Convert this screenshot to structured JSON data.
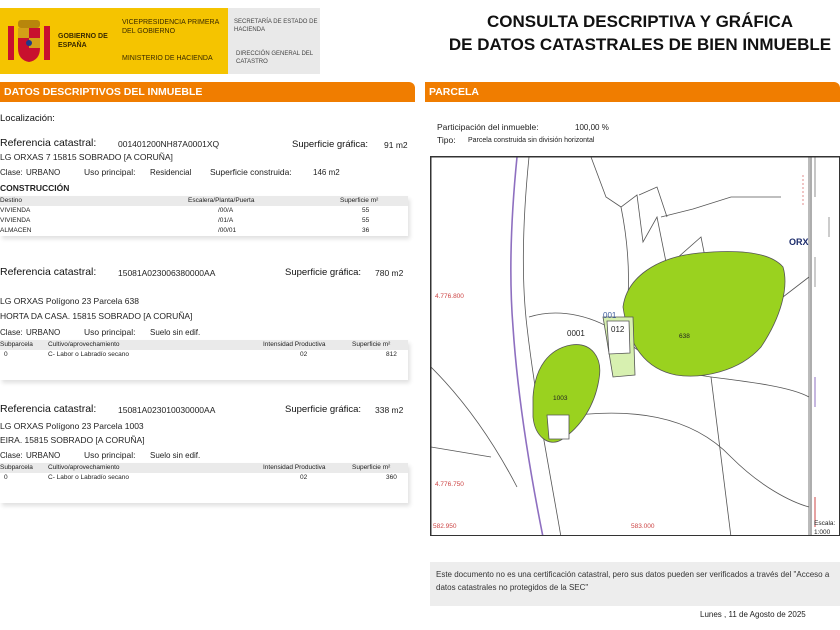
{
  "header": {
    "gob_name": "GOBIERNO DE ESPAÑA",
    "vicepresidencia": "VICEPRESIDENCIA PRIMERA DEL GOBIERNO",
    "ministerio": "MINISTERIO DE HACIENDA",
    "secretaria": "SECRETARÍA DE ESTADO DE HACIENDA",
    "direccion": "DIRECCIÓN GENERAL DEL CATASTRO",
    "title_line1": "CONSULTA DESCRIPTIVA Y GRÁFICA",
    "title_line2": "DE DATOS CATASTRALES DE BIEN INMUEBLE"
  },
  "left": {
    "section_title": "DATOS DESCRIPTIVOS DEL INMUEBLE",
    "localizacion": "Localización:",
    "block1": {
      "ref_label": "Referencia catastral:",
      "ref_value": "001401200NH87A0001XQ",
      "sup_label": "Superficie gráfica:",
      "sup_value": "91 m2",
      "address": "LG ORXAS 7   15815 SOBRADO [A CORUÑA]",
      "clase_label": "Clase:",
      "clase_value": "URBANO",
      "uso_label": "Uso principal:",
      "uso_value": "Residencial",
      "supc_label": "Superficie construida:",
      "supc_value": "146 m2",
      "construccion": "CONSTRUCCIÓN",
      "headers": [
        "Destino",
        "Escalera/Planta/Puerta",
        "Superficie m²"
      ],
      "rows": [
        [
          "VIVIENDA",
          "/00/A",
          "55"
        ],
        [
          "VIVIENDA",
          "/01/A",
          "55"
        ],
        [
          "ALMACEN",
          "/00/01",
          "36"
        ]
      ]
    },
    "block2": {
      "ref_label": "Referencia catastral:",
      "ref_value": "15081A023006380000AA",
      "sup_label": "Superficie gráfica:",
      "sup_value": "780 m2",
      "address1": "LG ORXAS  Polígono 23 Parcela 638",
      "address2": "HORTA DA CASA. 15815 SOBRADO [A CORUÑA]",
      "clase_label": "Clase:",
      "clase_value": "URBANO",
      "uso_label": "Uso principal:",
      "uso_value": "Suelo sin edif.",
      "headers": [
        "Subparcela",
        "Cultivo/aprovechamiento",
        "Intensidad Productiva",
        "Superficie m²"
      ],
      "rows": [
        [
          "0",
          "C- Labor o Labradío secano",
          "02",
          "812"
        ]
      ]
    },
    "block3": {
      "ref_label": "Referencia catastral:",
      "ref_value": "15081A023010030000AA",
      "sup_label": "Superficie gráfica:",
      "sup_value": "338 m2",
      "address1": "LG ORXAS  Polígono 23 Parcela 1003",
      "address2": "EIRA. 15815 SOBRADO [A CORUÑA]",
      "clase_label": "Clase:",
      "clase_value": "URBANO",
      "uso_label": "Uso principal:",
      "uso_value": "Suelo sin edif.",
      "headers": [
        "Subparcela",
        "Cultivo/aprovechamiento",
        "Intensidad Productiva",
        "Superficie m²"
      ],
      "rows": [
        [
          "0",
          "C- Labor o Labradío secano",
          "02",
          "360"
        ]
      ]
    }
  },
  "right": {
    "section_title": "PARCELA",
    "participacion_label": "Participación del inmueble:",
    "participacion_value": "100,00 %",
    "tipo_label": "Tipo:",
    "tipo_value": "Parcela construida sin división horizontal",
    "map": {
      "coord_y1": "4.776.800",
      "coord_y2": "4.776.750",
      "coord_x1": "582.950",
      "coord_x2": "583.000",
      "label_orx": "ORX",
      "label_0001": "0001",
      "label_001": "001",
      "label_012": "012",
      "label_638": "638",
      "label_1003": "1003",
      "escala": "Escala:",
      "escala_value": "1:000",
      "colors": {
        "parcel_fill": "#9ad21f",
        "line": "#555555",
        "road": "#8e6fc0"
      }
    },
    "note": "Este documento no es una certificación catastral, pero sus datos pueden ser verificados a través del \"Acceso a datos catastrales no protegidos de la SEC\"",
    "date": "Lunes , 11 de Agosto de 2025"
  }
}
